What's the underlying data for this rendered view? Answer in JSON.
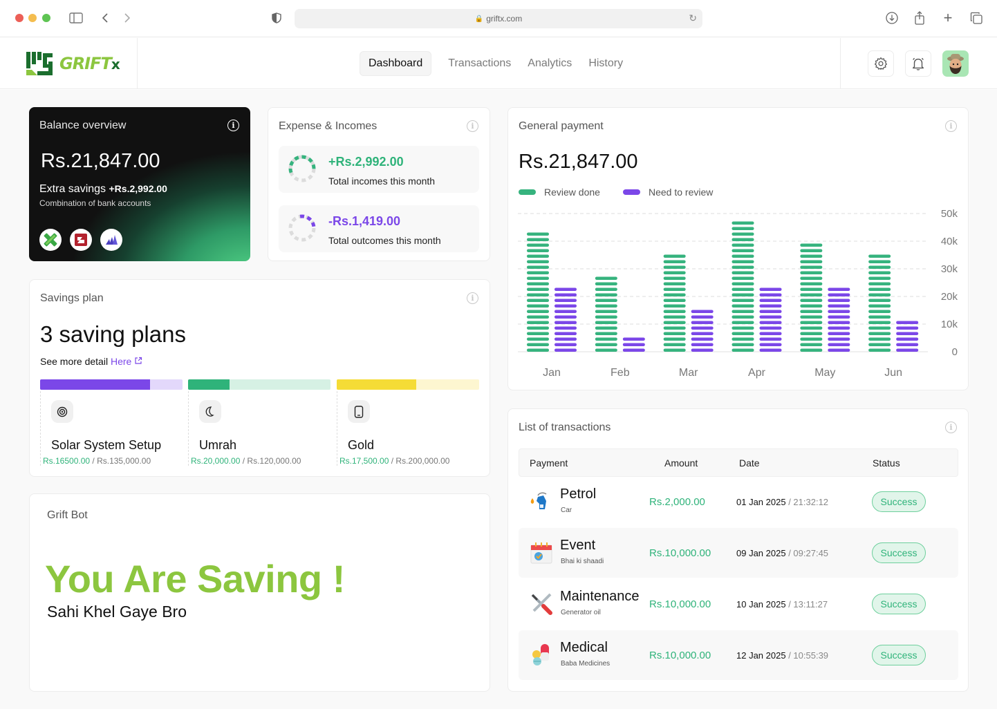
{
  "browser": {
    "url": "griftx.com",
    "icons": [
      "sidebar-icon",
      "back-icon",
      "forward-icon",
      "shield-icon",
      "reload-icon",
      "download-icon",
      "share-icon",
      "new-tab-icon",
      "tabs-icon"
    ]
  },
  "header": {
    "logo_text": "GRIFT",
    "logo_suffix": "x",
    "nav": [
      {
        "label": "Dashboard",
        "active": true
      },
      {
        "label": "Transactions",
        "active": false
      },
      {
        "label": "Analytics",
        "active": false
      },
      {
        "label": "History",
        "active": false
      }
    ],
    "icons": [
      "settings-icon",
      "bell-icon",
      "avatar"
    ]
  },
  "balance": {
    "title": "Balance overview",
    "amount": "Rs.21,847.00",
    "extra_label": "Extra savings",
    "extra_value": "+Rs.2,992.00",
    "subtitle": "Combination of bank accounts",
    "banks": [
      "bank-logo-green",
      "bank-logo-red",
      "bank-logo-purple"
    ]
  },
  "expense": {
    "title": "Expense & Incomes",
    "income": {
      "value": "+Rs.2,992.00",
      "label": "Total incomes this month",
      "color": "#2fb37a"
    },
    "outcome": {
      "value": "-Rs.1,419.00",
      "label": "Total outcomes this month",
      "color": "#7b47e8"
    }
  },
  "general": {
    "title": "General payment",
    "amount": "Rs.21,847.00"
  },
  "chart_data": {
    "type": "bar",
    "title": "General payment",
    "categories": [
      "Jan",
      "Feb",
      "Mar",
      "Apr",
      "May",
      "Jun"
    ],
    "series": [
      {
        "name": "Review done",
        "color": "#36b37e",
        "values": [
          43000,
          29000,
          35000,
          47000,
          39000,
          35000
        ]
      },
      {
        "name": "Need to review",
        "color": "#7b47e8",
        "values": [
          23000,
          5000,
          15000,
          23000,
          23000,
          11000
        ]
      }
    ],
    "yticks": [
      "0",
      "10k",
      "20k",
      "30k",
      "40k",
      "50k"
    ],
    "ylim": [
      0,
      50000
    ],
    "grid": true,
    "legend": "top-left",
    "xlabel": "",
    "ylabel": ""
  },
  "savings": {
    "title": "Savings plan",
    "headline": "3 saving plans",
    "more_text": "See more detail",
    "more_link": "Here",
    "plans": [
      {
        "name": "Solar System Setup",
        "saved": "Rs.16500.00",
        "target": "Rs.135,000.00",
        "progress": 0.77,
        "color": "#7b47e8",
        "track": "#e3d8fb",
        "icon": "target-icon"
      },
      {
        "name": "Umrah",
        "saved": "Rs.20,000.00",
        "target": "Rs.120,000.00",
        "progress": 0.29,
        "color": "#2fb37a",
        "track": "#d6f1e4",
        "icon": "moon-icon"
      },
      {
        "name": "Gold",
        "saved": "Rs.17,500.00",
        "target": "Rs.200,000.00",
        "progress": 0.56,
        "color": "#f5dc36",
        "track": "#fdf6d0",
        "icon": "phone-icon"
      }
    ]
  },
  "bot": {
    "title": "Grift Bot",
    "headline": "You Are Saving !",
    "subline": "Sahi Khel Gaye Bro"
  },
  "transactions": {
    "title": "List of transactions",
    "columns": [
      "Payment",
      "Amount",
      "Date",
      "Status"
    ],
    "rows": [
      {
        "name": "Petrol",
        "sub": "Car",
        "amount": "Rs.2,000.00",
        "date": "01 Jan 2025",
        "time": "/ 21:32:12",
        "status": "Success",
        "icon": "fuel-pump-icon"
      },
      {
        "name": "Event",
        "sub": "Bhai ki shaadi",
        "amount": "Rs.10,000.00",
        "date": "09 Jan 2025",
        "time": "/ 09:27:45",
        "status": "Success",
        "icon": "calendar-icon"
      },
      {
        "name": "Maintenance",
        "sub": "Generator oil",
        "amount": "Rs.10,000.00",
        "date": "10 Jan 2025",
        "time": "/ 13:11:27",
        "status": "Success",
        "icon": "tools-icon"
      },
      {
        "name": "Medical",
        "sub": "Baba Medicines",
        "amount": "Rs.10,000.00",
        "date": "12 Jan 2025",
        "time": "/ 10:55:39",
        "status": "Success",
        "icon": "pills-icon"
      }
    ]
  }
}
